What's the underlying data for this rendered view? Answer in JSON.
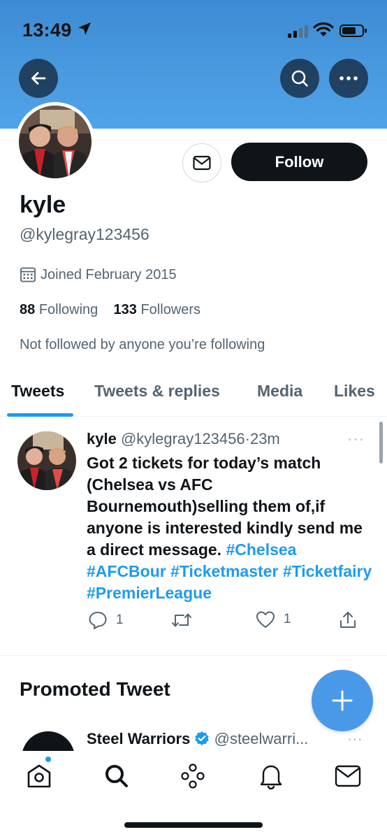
{
  "status_bar": {
    "time": "13:49"
  },
  "profile": {
    "name": "kyle",
    "handle": "@kylegray123456",
    "joined": "Joined February 2015",
    "following_count": "88",
    "following_label": "Following",
    "followers_count": "133",
    "followers_label": "Followers",
    "not_followed_note": "Not followed by anyone you’re following",
    "follow_label": "Follow"
  },
  "tabs": [
    {
      "label": "Tweets",
      "active": true
    },
    {
      "label": "Tweets & replies",
      "active": false
    },
    {
      "label": "Media",
      "active": false
    },
    {
      "label": "Likes",
      "active": false
    }
  ],
  "tweet": {
    "name": "kyle",
    "handle": "@kylegray123456",
    "separator": "·",
    "time": "23m",
    "text": "Got 2 tickets for today’s match (Chelsea vs AFC Bournemouth)selling them of,if anyone is interested kindly send me a direct message.",
    "hashtags": [
      "#Chelsea",
      "#AFCBour",
      "#Ticketmaster",
      "#Ticketfairy",
      "#PremierLeague"
    ],
    "replies": "1",
    "likes": "1",
    "more": "···"
  },
  "promoted": {
    "heading": "Promoted Tweet",
    "name": "Steel Warriors",
    "handle": "@steelwarri...",
    "more": "···"
  },
  "colors": {
    "accent": "#1d9bf0",
    "banner": "#4a9be0",
    "fab": "#4a99e9",
    "text": "#0f1419",
    "muted": "#536471"
  },
  "icons": [
    "back-arrow-icon",
    "search-icon",
    "more-icon",
    "mail-icon",
    "calendar-icon",
    "reply-icon",
    "retweet-icon",
    "like-icon",
    "share-icon",
    "plus-icon",
    "home-icon",
    "explore-icon",
    "spaces-icon",
    "notifications-icon",
    "messages-icon",
    "verified-icon"
  ]
}
